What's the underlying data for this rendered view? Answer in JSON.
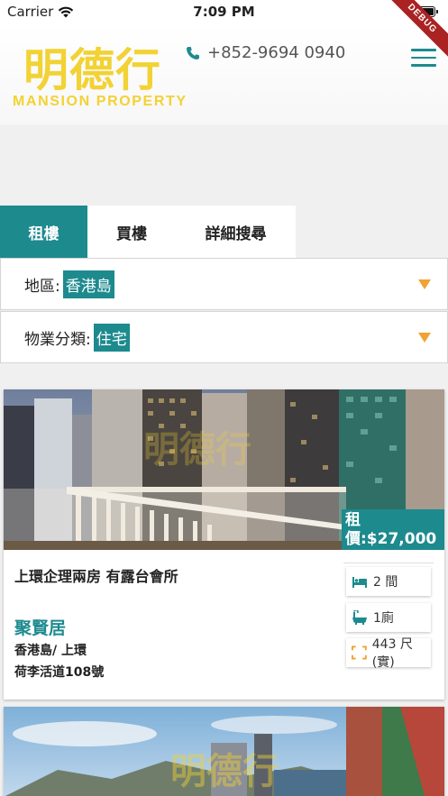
{
  "status_bar": {
    "carrier": "Carrier",
    "time": "7:09 PM"
  },
  "header": {
    "logo_cn": "明德行",
    "logo_en": "MANSION PROPERTY",
    "phone": "+852-9694 0940",
    "debug_label": "DEBUG"
  },
  "tabs": [
    {
      "label": "租樓",
      "active": true
    },
    {
      "label": "買樓",
      "active": false
    },
    {
      "label": "詳細搜尋",
      "active": false
    }
  ],
  "filters": {
    "region": {
      "label": "地區:",
      "value": "香港島"
    },
    "category": {
      "label": "物業分類:",
      "value": "住宅"
    }
  },
  "listing": {
    "price": "租價:$27,000",
    "title": "上環企理兩房 有露台會所",
    "estate": "聚賢居",
    "district": "香港島/ 上環",
    "street": "荷李活道108號",
    "bedrooms": "2 間",
    "bathrooms": "1廁",
    "area": "443 尺(實)",
    "watermark": "明德行"
  },
  "colors": {
    "teal": "#1d8a8e",
    "gold": "#f2d234",
    "orange": "#f0a233"
  }
}
